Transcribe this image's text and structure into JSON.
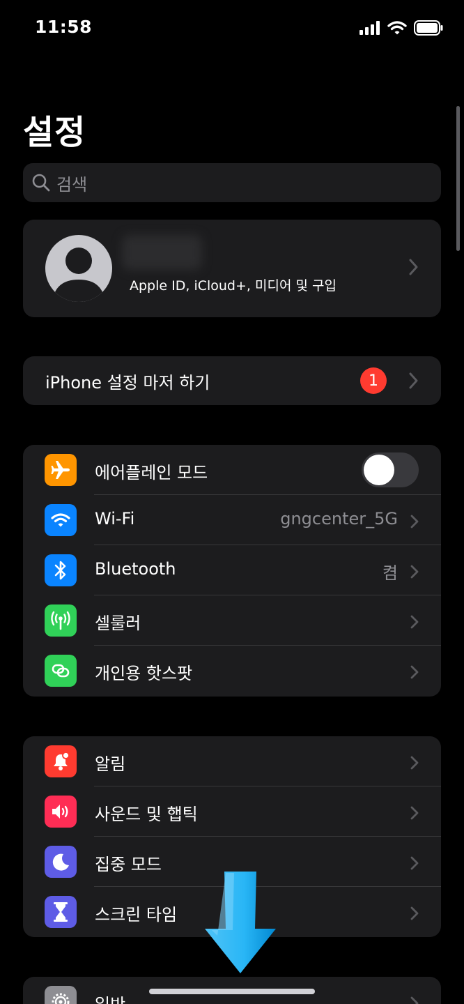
{
  "status_bar": {
    "time": "11:58",
    "icons": [
      "cellular-signal-icon",
      "wifi-icon",
      "battery-icon"
    ]
  },
  "page": {
    "title": "설정",
    "search_placeholder": "검색"
  },
  "profile": {
    "subtitle": "Apple ID, iCloud+, 미디어 및 구입"
  },
  "setup": {
    "label": "iPhone 설정 마저 하기",
    "badge": "1"
  },
  "network_group": [
    {
      "label": "에어플레인 모드",
      "icon": "airplane-icon",
      "color": "#ff9500",
      "toggle": false
    },
    {
      "label": "Wi-Fi",
      "value": "gngcenter_5G",
      "icon": "wifi-icon",
      "color": "#0a84ff"
    },
    {
      "label": "Bluetooth",
      "value": "켬",
      "icon": "bluetooth-icon",
      "color": "#0a84ff"
    },
    {
      "label": "셀룰러",
      "icon": "cellular-antenna-icon",
      "color": "#30d158"
    },
    {
      "label": "개인용 핫스팟",
      "icon": "hotspot-icon",
      "color": "#30d158"
    }
  ],
  "alerts_group": [
    {
      "label": "알림",
      "icon": "bell-icon",
      "color": "#ff3b30"
    },
    {
      "label": "사운드 및 햅틱",
      "icon": "speaker-icon",
      "color": "#ff2d55"
    },
    {
      "label": "집중 모드",
      "icon": "moon-icon",
      "color": "#5e5ce6"
    },
    {
      "label": "스크린 타임",
      "icon": "hourglass-icon",
      "color": "#5e5ce6"
    }
  ],
  "general_group": [
    {
      "label": "일반",
      "icon": "gear-icon",
      "color": "#8e8e93"
    }
  ],
  "colors": {
    "background": "#000000",
    "cell": "#1c1c1e",
    "secondary_text": "#8e8e93",
    "badge": "#ff3b30",
    "annotation_arrow": "#29b6f6"
  }
}
